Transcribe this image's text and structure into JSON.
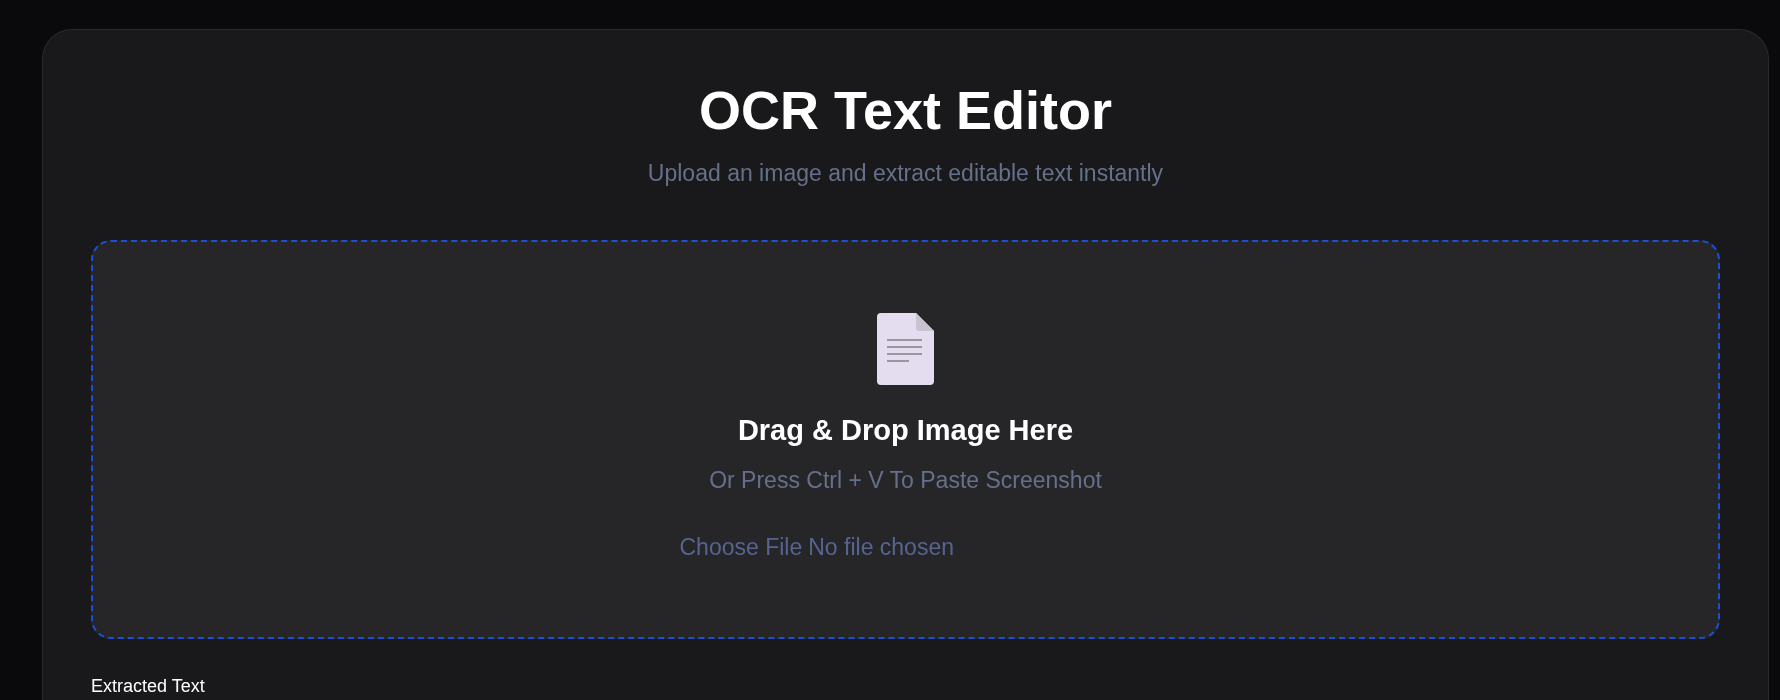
{
  "header": {
    "title": "OCR Text Editor",
    "subtitle": "Upload an image and extract editable text instantly"
  },
  "dropzone": {
    "heading": "Drag & Drop Image Here",
    "hint": "Or Press Ctrl + V To Paste Screenshot",
    "file_input": {
      "button": "Choose File",
      "status": "No file chosen"
    }
  },
  "output": {
    "label": "Extracted Text"
  }
}
